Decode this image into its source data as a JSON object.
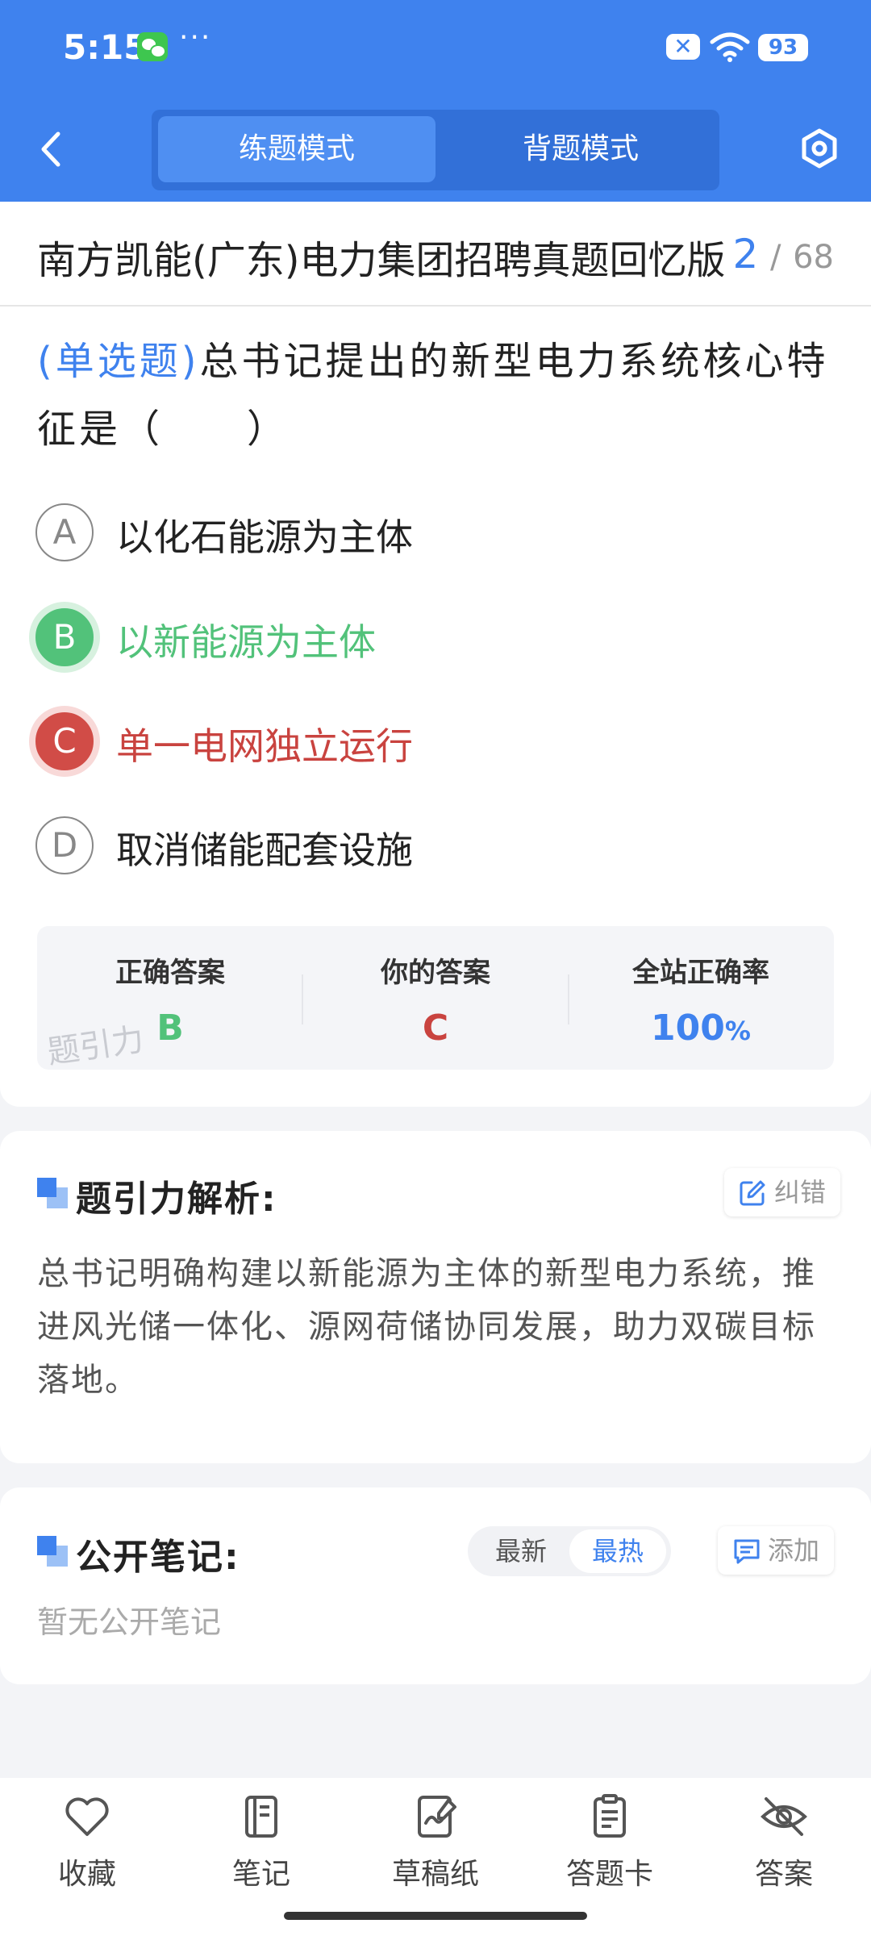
{
  "status_bar": {
    "time": "5:15",
    "dots": "···",
    "battery": "93"
  },
  "header": {
    "modes": [
      {
        "label": "练题模式",
        "active": true
      },
      {
        "label": "背题模式",
        "active": false
      }
    ]
  },
  "paper": {
    "title": "南方凯能(广东)电力集团招聘真题回忆版",
    "current": "2",
    "separator": "/",
    "total": "68"
  },
  "question": {
    "type": "(单选题)",
    "text": "总书记提出的新型电力系统核心特征是（　　）",
    "options": [
      {
        "letter": "A",
        "text": "以化石能源为主体",
        "state": "normal"
      },
      {
        "letter": "B",
        "text": "以新能源为主体",
        "state": "correct"
      },
      {
        "letter": "C",
        "text": "单一电网独立运行",
        "state": "wrong"
      },
      {
        "letter": "D",
        "text": "取消储能配套设施",
        "state": "normal"
      }
    ]
  },
  "answer_summary": {
    "correct_label": "正确答案",
    "correct_value": "B",
    "yours_label": "你的答案",
    "yours_value": "C",
    "rate_label": "全站正确率",
    "rate_value": "100",
    "rate_unit": "%",
    "watermark": "题引力"
  },
  "analysis": {
    "title": "题引力解析:",
    "report_label": "纠错",
    "text": "总书记明确构建以新能源为主体的新型电力系统，推进风光储一体化、源网荷储协同发展，助力双碳目标落地。"
  },
  "notes": {
    "title": "公开笔记:",
    "sort_options": [
      "最新",
      "最热"
    ],
    "add_label": "添加",
    "empty_text": "暂无公开笔记"
  },
  "bottom_nav": [
    {
      "label": "收藏",
      "icon": "heart-icon"
    },
    {
      "label": "笔记",
      "icon": "notebook-icon"
    },
    {
      "label": "草稿纸",
      "icon": "draft-icon"
    },
    {
      "label": "答题卡",
      "icon": "answer-sheet-icon"
    },
    {
      "label": "答案",
      "icon": "eye-off-icon"
    }
  ],
  "colors": {
    "primary": "#3f82ee",
    "correct": "#52c27a",
    "wrong": "#d14c47"
  }
}
